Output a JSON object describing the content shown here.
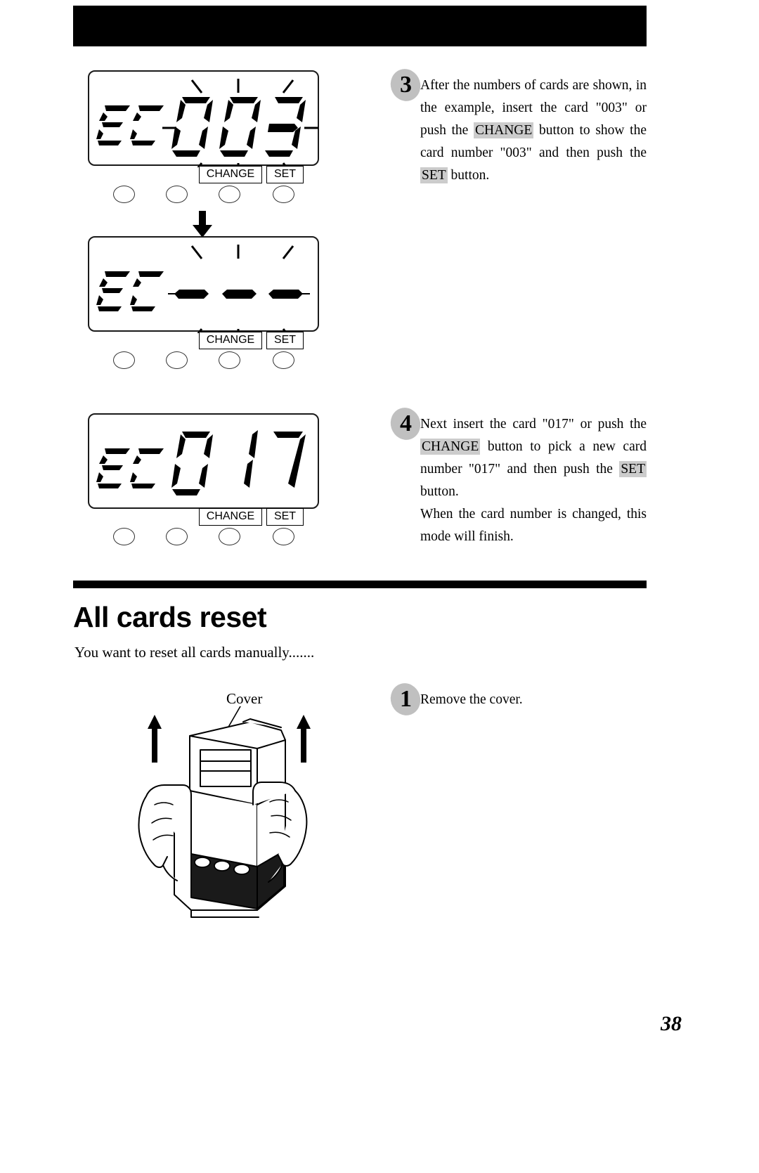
{
  "page": {
    "number": "38"
  },
  "header": {
    "bar_color": "#000000"
  },
  "displays": [
    {
      "id": "lcd-003",
      "prefix": "EC",
      "value": "003",
      "digits": [
        "0",
        "0",
        "3"
      ],
      "blinking": true
    },
    {
      "id": "lcd-dashes",
      "prefix": "EC",
      "value": "- - -",
      "digits": [
        "-",
        "-",
        "-"
      ],
      "blinking": true
    },
    {
      "id": "lcd-017",
      "prefix": "EC",
      "value": "017",
      "digits": [
        "0",
        "1",
        "7"
      ],
      "blinking": false
    }
  ],
  "buttons": {
    "change_label": "CHANGE",
    "set_label": "SET",
    "count": 4
  },
  "steps": [
    {
      "number": "3",
      "text_runs": [
        {
          "t": "After the numbers of cards are shown, in the example, insert the card \"003\" or push the ",
          "hl": false
        },
        {
          "t": "CHANGE",
          "hl": true
        },
        {
          "t": " button to show the card number \"003\" and then push the ",
          "hl": false
        },
        {
          "t": "SET",
          "hl": true
        },
        {
          "t": " button.",
          "hl": false
        }
      ]
    },
    {
      "number": "4",
      "text_runs": [
        {
          "t": "Next insert the card \"017\" or push the ",
          "hl": false
        },
        {
          "t": "CHANGE",
          "hl": true
        },
        {
          "t": " button to pick a new card number \"017\" and then push the ",
          "hl": false
        },
        {
          "t": "SET",
          "hl": true
        },
        {
          "t": " button.",
          "hl": false
        }
      ],
      "extra_paragraph": "When the card number is changed, this mode will finish."
    },
    {
      "number": "1",
      "text_runs": [
        {
          "t": "Remove the cover.",
          "hl": false
        }
      ]
    }
  ],
  "section": {
    "title": "All cards reset",
    "subtitle": "You want to reset all cards manually......."
  },
  "illustration": {
    "cover_label": "Cover"
  },
  "colors": {
    "highlight": "#cccccc",
    "badge": "#c0c0c0",
    "ink": "#000000"
  }
}
